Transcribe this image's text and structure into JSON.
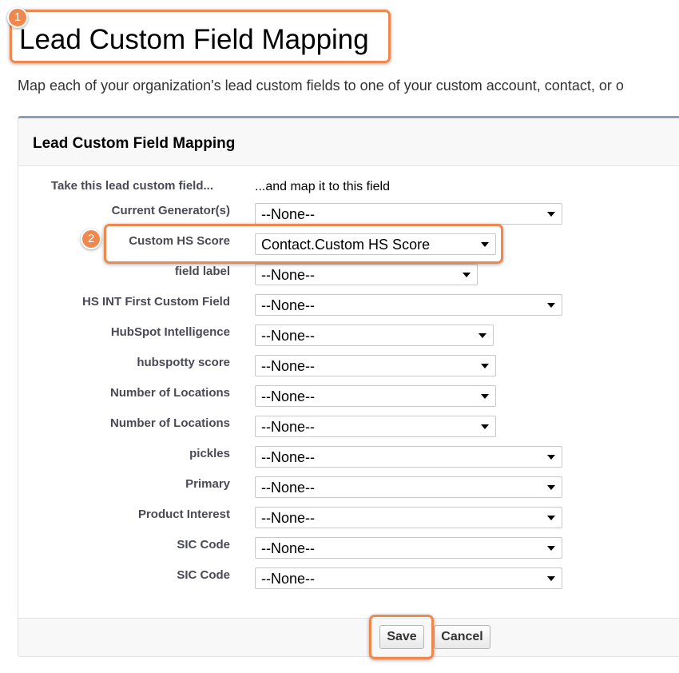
{
  "page": {
    "title": "Lead Custom Field Mapping",
    "description": "Map each of your organization's lead custom fields to one of your custom account, contact, or o"
  },
  "panel": {
    "title": "Lead Custom Field Mapping",
    "column_left": "Take this lead custom field...",
    "column_right": "...and map it to this field"
  },
  "rows": [
    {
      "label": "Current Generator(s)",
      "value": "--None--"
    },
    {
      "label": "Custom HS Score",
      "value": "Contact.Custom HS Score"
    },
    {
      "label": "field label",
      "value": "--None--"
    },
    {
      "label": "HS INT First Custom Field",
      "value": "--None--"
    },
    {
      "label": "HubSpot Intelligence",
      "value": "--None--"
    },
    {
      "label": "hubspotty score",
      "value": "--None--"
    },
    {
      "label": "Number of Locations",
      "value": "--None--"
    },
    {
      "label": "Number of Locations",
      "value": "--None--"
    },
    {
      "label": "pickles",
      "value": "--None--"
    },
    {
      "label": "Primary",
      "value": "--None--"
    },
    {
      "label": "Product Interest",
      "value": "--None--"
    },
    {
      "label": "SIC Code",
      "value": "--None--"
    },
    {
      "label": "SIC Code",
      "value": "--None--"
    }
  ],
  "buttons": {
    "save": "Save",
    "cancel": "Cancel"
  },
  "annotations": {
    "step1": "1",
    "step2": "2",
    "color": "#f0884e"
  }
}
